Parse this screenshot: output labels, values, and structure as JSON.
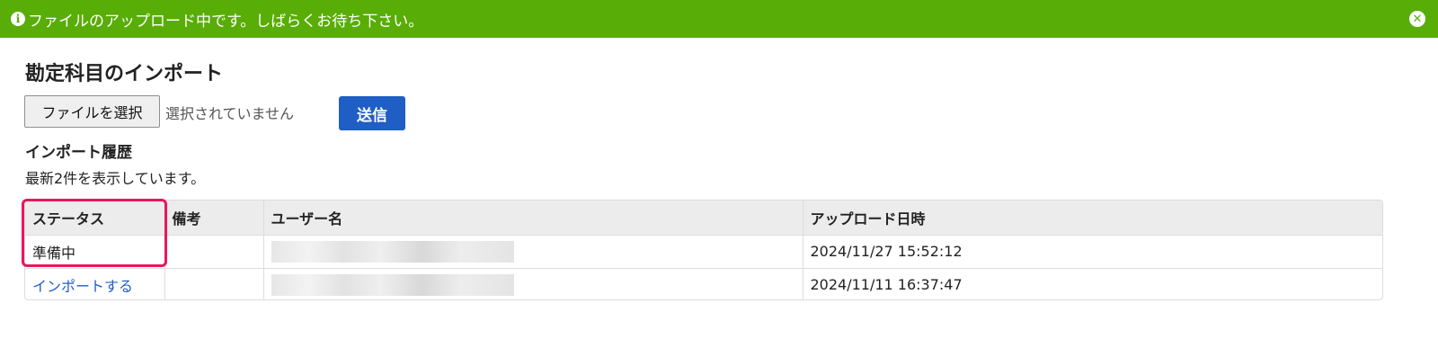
{
  "banner": {
    "message": "ファイルのアップロード中です。しばらくお待ち下さい。",
    "color": "#58ad06"
  },
  "page": {
    "title": "勘定科目のインポート"
  },
  "upload": {
    "file_button_label": "ファイルを選択",
    "file_status": "選択されていません",
    "submit_label": "送信"
  },
  "history": {
    "title": "インポート履歴",
    "note": "最新2件を表示しています。",
    "headers": {
      "status": "ステータス",
      "remarks": "備考",
      "user": "ユーザー名",
      "uploaded_at": "アップロード日時"
    },
    "rows": [
      {
        "status": "準備中",
        "remarks": "",
        "uploaded_at": "2024/11/27 15:52:12"
      },
      {
        "status": "インポートする",
        "remarks": "",
        "uploaded_at": "2024/11/11 16:37:47"
      }
    ]
  },
  "colors": {
    "accent": "#1f5ec4",
    "highlight": "#e8175b"
  }
}
